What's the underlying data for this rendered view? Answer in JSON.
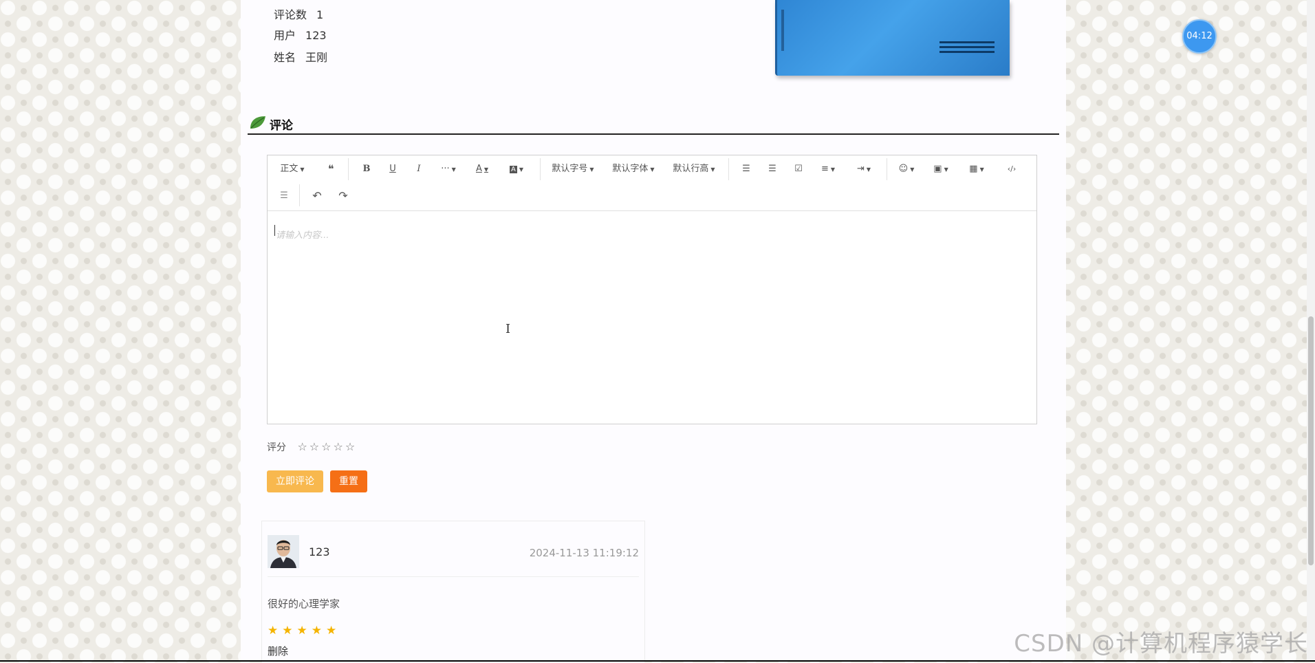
{
  "info": {
    "comment_count_label": "评论数",
    "comment_count_value": "1",
    "user_label": "用户",
    "user_value": "123",
    "name_label": "姓名",
    "name_value": "王刚"
  },
  "section": {
    "title": "评论",
    "icon": "leaf-icon"
  },
  "editor": {
    "toolbar_row1": [
      {
        "name": "paragraph-dropdown",
        "label": "正文",
        "caret": true
      },
      {
        "name": "quote-button",
        "label": "❝",
        "caret": false
      },
      {
        "name": "bold-button",
        "label": "B",
        "caret": false
      },
      {
        "name": "underline-button",
        "label": "U",
        "caret": false
      },
      {
        "name": "italic-button",
        "label": "I",
        "caret": false
      },
      {
        "name": "more-button",
        "label": "···",
        "caret": true
      },
      {
        "name": "font-color-button",
        "label": "A",
        "caret": true
      },
      {
        "name": "bg-color-button",
        "label": "A",
        "caret": true
      },
      {
        "name": "font-size-dropdown",
        "label": "默认字号",
        "caret": true
      },
      {
        "name": "font-family-dropdown",
        "label": "默认字体",
        "caret": true
      },
      {
        "name": "line-height-dropdown",
        "label": "默认行高",
        "caret": true
      },
      {
        "name": "bulleted-list-button",
        "label": "☰",
        "caret": false
      },
      {
        "name": "numbered-list-button",
        "label": "☰",
        "caret": false
      },
      {
        "name": "todo-button",
        "label": "☑",
        "caret": false
      },
      {
        "name": "align-button",
        "label": "≡",
        "caret": true
      },
      {
        "name": "indent-button",
        "label": "⇥",
        "caret": true
      },
      {
        "name": "emoji-button",
        "label": "☺",
        "caret": true
      },
      {
        "name": "image-button",
        "label": "▣",
        "caret": true
      },
      {
        "name": "table-button",
        "label": "▦",
        "caret": true
      },
      {
        "name": "code-button",
        "label": "‹/›",
        "caret": false
      }
    ],
    "toolbar_row2": [
      {
        "name": "divider-button",
        "label": "☰",
        "caret": false
      },
      {
        "name": "undo-button",
        "label": "↶",
        "caret": false
      },
      {
        "name": "redo-button",
        "label": "↷",
        "caret": false
      }
    ],
    "placeholder": "请输入内容..."
  },
  "rating": {
    "label": "评分",
    "stars": "☆☆☆☆☆"
  },
  "buttons": {
    "submit": "立即评论",
    "reset": "重置"
  },
  "comment": {
    "user": "123",
    "time": "2024-11-13 11:19:12",
    "text": "很好的心理学家",
    "stars": "★★★★★",
    "rating_value": 5,
    "delete": "删除"
  },
  "timer": "04:12",
  "watermark": "CSDN @计算机程序猿学长",
  "colors": {
    "submit_bg": "#f8b84e",
    "reset_bg": "#f56f16",
    "star_gold": "#f5b400",
    "timer_blue": "#3d98f0"
  }
}
